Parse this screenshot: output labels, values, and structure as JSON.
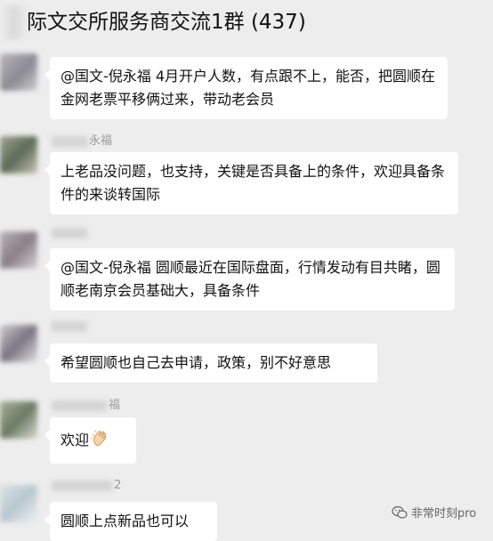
{
  "header": {
    "title": "际文交所服务商交流1群 (437)"
  },
  "messages": [
    {
      "sender": "",
      "text": "@国文-倪永福 4月开户人数，有点跟不上，能否，把圆顺在金网老票平移俩过来，带动老会员"
    },
    {
      "sender": "永福",
      "text": "上老品没问题，也支持，关键是否具备上的条件，欢迎具备条件的来谈转国际"
    },
    {
      "sender": "",
      "text": "@国文-倪永福 圆顺最近在国际盘面，行情发动有目共睹，圆顺老南京会员基础大，具备条件"
    },
    {
      "sender": "",
      "text": "希望圆顺也自己去申请，政策，别不好意思"
    },
    {
      "sender": "福",
      "text": "欢迎",
      "emoji": "clapping-hands"
    },
    {
      "sender": "2",
      "text": "圆顺上点新品也可以"
    }
  ],
  "watermark": {
    "text": "非常时刻pro"
  }
}
